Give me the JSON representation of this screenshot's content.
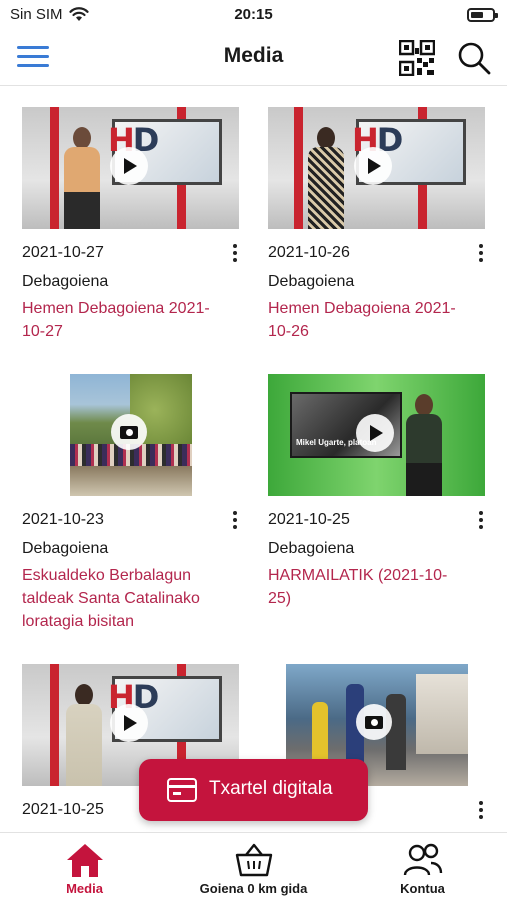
{
  "status_bar": {
    "carrier": "Sin SIM",
    "time": "20:15",
    "icons": [
      "wifi-icon",
      "battery-icon"
    ]
  },
  "header": {
    "title": "Media",
    "icons": [
      "menu-icon",
      "qr-code-icon",
      "search-icon"
    ]
  },
  "cards": [
    {
      "date": "2021-10-27",
      "source": "Debagoiena",
      "title": "Hemen Debagoiena 2021-10-27",
      "title_line1": "Hemen Debagoiena 2021-",
      "title_line2": "10-27",
      "title_line3": "",
      "media_type": "video"
    },
    {
      "date": "2021-10-26",
      "source": "Debagoiena",
      "title": "Hemen Debagoiena 2021-10-26",
      "title_line1": "Hemen Debagoiena 2021-",
      "title_line2": "10-26",
      "title_line3": "",
      "media_type": "video"
    },
    {
      "date": "2021-10-23",
      "source": "Debagoiena",
      "title": "Eskualdeko Berbalagun taldeak Santa Catalinako loratagia bisitan",
      "title_line1": "Eskualdeko Berbalagun",
      "title_line2": "taldeak Santa Catalinako",
      "title_line3": "loratagia bisitan",
      "media_type": "gallery"
    },
    {
      "date": "2021-10-25",
      "source": "Debagoiena",
      "title": "HARMAILATIK (2021-10-25)",
      "title_line1": "HARMAILATIK (2021-10-",
      "title_line2": "25)",
      "title_line3": "",
      "media_type": "video"
    },
    {
      "date": "2021-10-25",
      "source": "",
      "title": "",
      "title_line1": "",
      "title_line2": "",
      "title_line3": "",
      "media_type": "video"
    },
    {
      "date": "",
      "source": "",
      "title": "",
      "title_line1": "",
      "title_line2": "",
      "title_line3": "",
      "media_type": "gallery"
    }
  ],
  "thumb_text": {
    "hd_h": "H",
    "hd_d": "D",
    "caption": "Mikel Ugarte, platoan"
  },
  "digital_card_button": {
    "label": "Txartel digitala",
    "icon": "credit-card-icon"
  },
  "bottom_nav": [
    {
      "label": "Media",
      "icon": "home-icon",
      "active": true
    },
    {
      "label": "Goiena 0 km gida",
      "icon": "basket-icon",
      "active": false
    },
    {
      "label": "Kontua",
      "icon": "users-icon",
      "active": false
    }
  ],
  "colors": {
    "accent": "#c4143d",
    "link": "#b3264d",
    "menu": "#3a7bd5"
  }
}
